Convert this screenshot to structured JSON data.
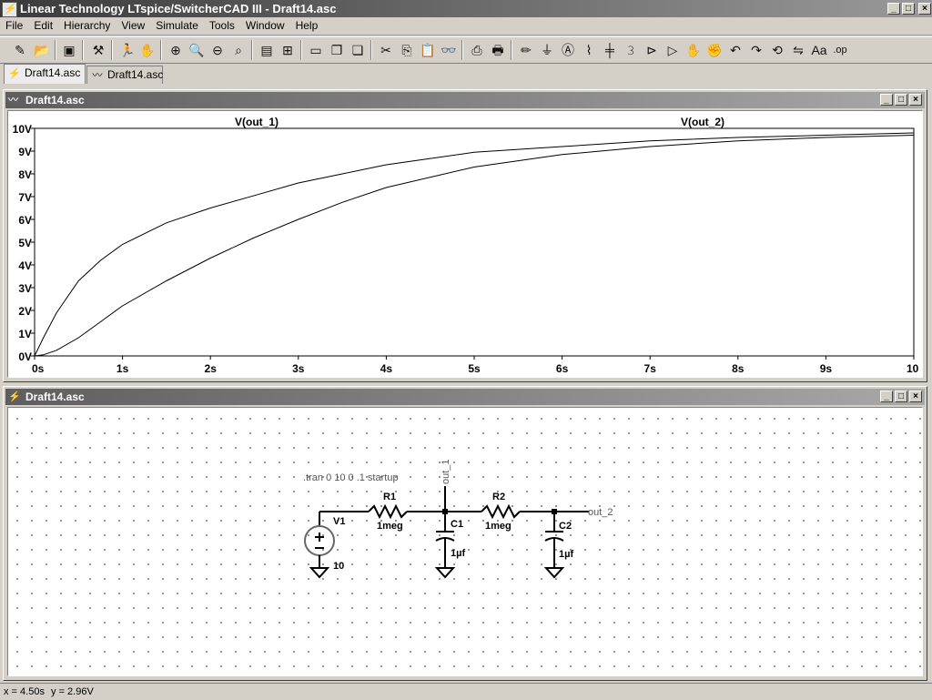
{
  "window": {
    "title": "Linear Technology LTspice/SwitcherCAD III - Draft14.asc"
  },
  "menu": [
    "File",
    "Edit",
    "Hierarchy",
    "View",
    "Simulate",
    "Tools",
    "Window",
    "Help"
  ],
  "tabs": [
    {
      "label": "Draft14.asc",
      "icon": "schematic-icon"
    },
    {
      "label": "Draft14.asc",
      "icon": "waveform-icon"
    }
  ],
  "waveform_window": {
    "title": "Draft14.asc"
  },
  "schematic_window": {
    "title": "Draft14.asc"
  },
  "chart_data": {
    "type": "line",
    "title": "",
    "xlabel": "",
    "ylabel": "",
    "xlim": [
      0,
      10
    ],
    "ylim": [
      0,
      10
    ],
    "x_ticks": [
      "0s",
      "1s",
      "2s",
      "3s",
      "4s",
      "5s",
      "6s",
      "7s",
      "8s",
      "9s",
      "10s"
    ],
    "y_ticks": [
      "0V",
      "1V",
      "2V",
      "3V",
      "4V",
      "5V",
      "6V",
      "7V",
      "8V",
      "9V",
      "10V"
    ],
    "grid": false,
    "series": [
      {
        "name": "V(out_1)",
        "x": [
          0,
          0.1,
          0.25,
          0.5,
          0.75,
          1,
          1.5,
          2,
          2.5,
          3,
          3.5,
          4,
          5,
          6,
          7,
          8,
          9,
          10
        ],
        "y": [
          0,
          0.8,
          1.9,
          3.3,
          4.2,
          4.9,
          5.85,
          6.5,
          7.05,
          7.6,
          8.0,
          8.4,
          8.95,
          9.2,
          9.45,
          9.6,
          9.7,
          9.8
        ]
      },
      {
        "name": "V(out_2)",
        "x": [
          0,
          0.1,
          0.25,
          0.5,
          0.75,
          1,
          1.5,
          2,
          2.5,
          3,
          3.5,
          4,
          5,
          6,
          7,
          8,
          9,
          10
        ],
        "y": [
          0,
          0.05,
          0.25,
          0.8,
          1.5,
          2.2,
          3.3,
          4.3,
          5.2,
          6.0,
          6.75,
          7.4,
          8.3,
          8.85,
          9.2,
          9.45,
          9.6,
          9.7
        ]
      }
    ]
  },
  "schematic": {
    "directive": ".tran 0 10 0 .1 startup",
    "net_out1": "out_1",
    "net_out2": "out_2",
    "v1_name": "V1",
    "v1_value": "10",
    "r1_name": "R1",
    "r1_value": "1meg",
    "r2_name": "R2",
    "r2_value": "1meg",
    "c1_name": "C1",
    "c1_value": "1µf",
    "c2_name": "C2",
    "c2_value": "1µf"
  },
  "status": {
    "x": "x = 4.50s",
    "y": "y = 2.96V"
  }
}
